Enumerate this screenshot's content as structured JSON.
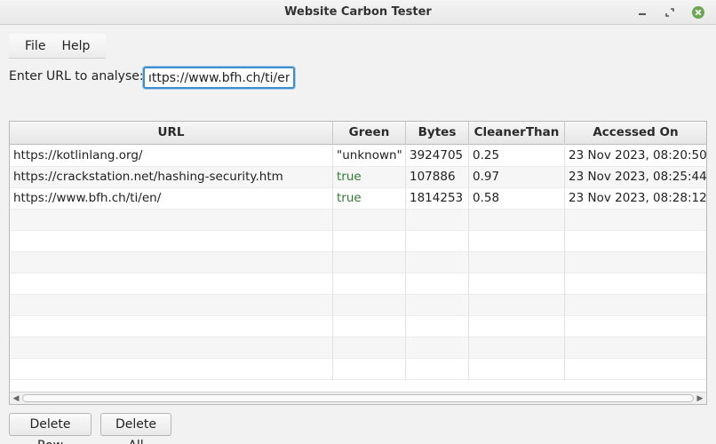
{
  "window": {
    "title": "Website Carbon Tester",
    "controls": [
      "minimize-icon",
      "restore-icon",
      "close-icon"
    ],
    "close_color": "#6aa84f"
  },
  "menubar": {
    "items": [
      {
        "label": "File"
      },
      {
        "label": "Help"
      }
    ]
  },
  "url_form": {
    "label": "Enter URL to analyse:",
    "value": "ıttps://www.bfh.ch/ti/en"
  },
  "table": {
    "columns": [
      "URL",
      "Green",
      "Bytes",
      "CleanerThan",
      "Accessed On"
    ],
    "rows": [
      {
        "url": "https://kotlinlang.org/",
        "green": "\"unknown\"",
        "bytes": "3924705",
        "cleaner_than": "0.25",
        "accessed_on": "23 Nov 2023, 08:20:50"
      },
      {
        "url": "https://crackstation.net/hashing-security.htm",
        "green": "true",
        "bytes": "107886",
        "cleaner_than": "0.97",
        "accessed_on": "23 Nov 2023, 08:25:44"
      },
      {
        "url": "https://www.bfh.ch/ti/en/",
        "green": "true",
        "bytes": "1814253",
        "cleaner_than": "0.58",
        "accessed_on": "23 Nov 2023, 08:28:12"
      }
    ],
    "green_true_color": "#2e7d32"
  },
  "buttons": {
    "delete_row": "Delete Row",
    "delete_all": "Delete All"
  }
}
